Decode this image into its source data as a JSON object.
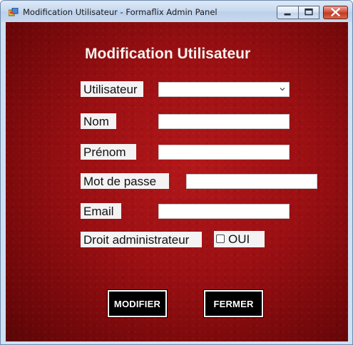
{
  "window": {
    "title": "Modification Utilisateur - Formaflix Admin Panel",
    "controls": {
      "minimize": "minimize-icon",
      "maximize": "maximize-icon",
      "close": "close-icon"
    }
  },
  "form": {
    "heading": "Modification Utilisateur",
    "utilisateur": {
      "label": "Utilisateur",
      "selected": ""
    },
    "nom": {
      "label": "Nom",
      "value": ""
    },
    "prenom": {
      "label": "Prénom",
      "value": ""
    },
    "mot_de_passe": {
      "label": "Mot de passe",
      "value": ""
    },
    "email": {
      "label": "Email",
      "value": ""
    },
    "droit_admin": {
      "label": "Droit administrateur",
      "checkbox_label": "OUI",
      "checked": false
    }
  },
  "actions": {
    "modifier": "MODIFIER",
    "fermer": "FERMER"
  },
  "colors": {
    "background": "#9a0f12",
    "button_bg": "#000000",
    "button_text": "#ffffff",
    "label_bg": "#f4f2f2"
  }
}
